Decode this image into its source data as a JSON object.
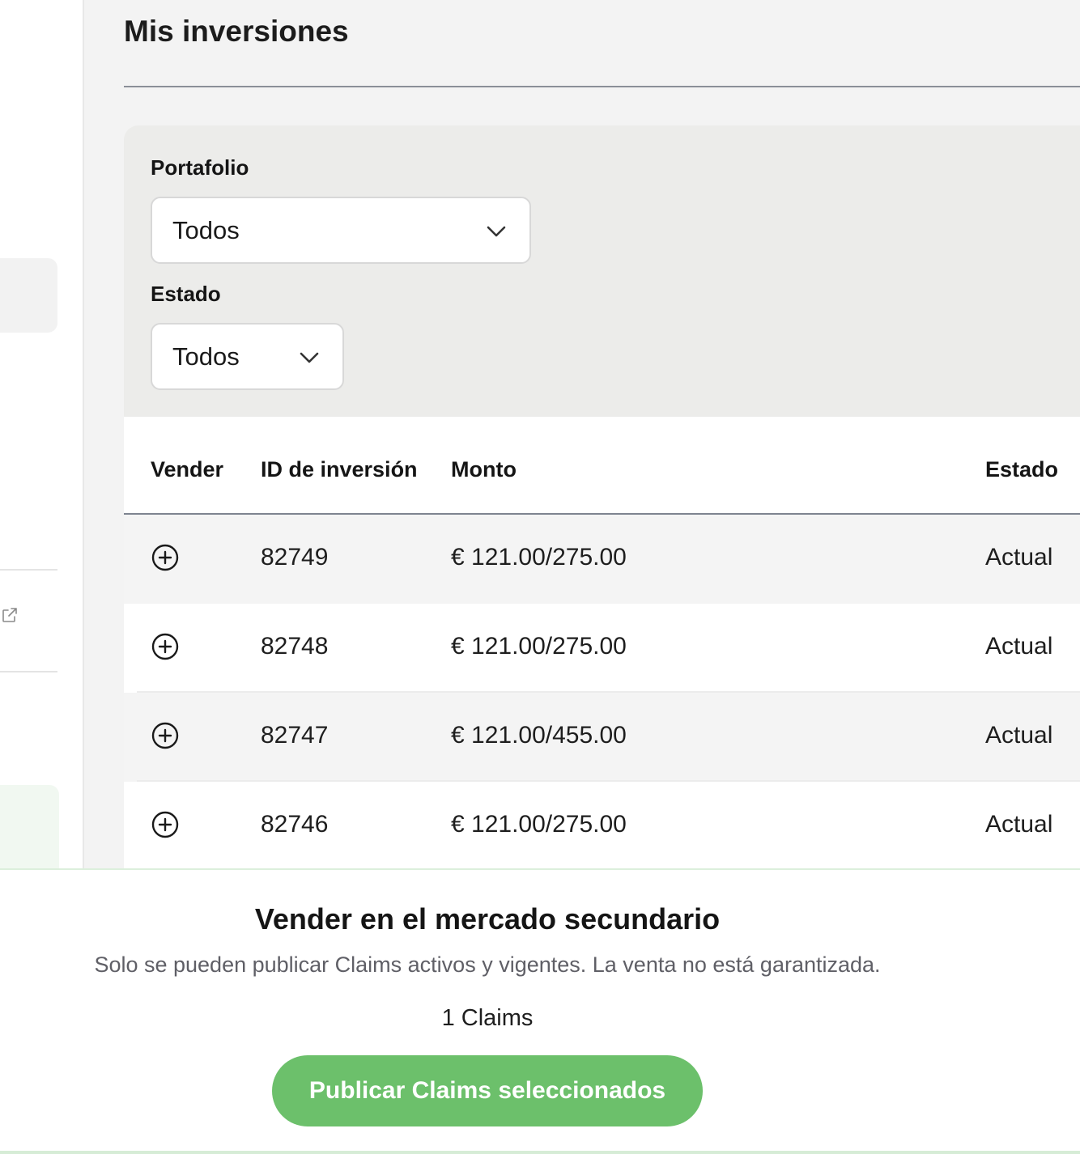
{
  "page": {
    "title": "Mis inversiones"
  },
  "filters": {
    "portfolio": {
      "label": "Portafolio",
      "value": "Todos"
    },
    "status": {
      "label": "Estado",
      "value": "Todos"
    }
  },
  "table": {
    "headers": [
      "Vender",
      "ID de inversión",
      "Monto",
      "Estado"
    ],
    "rows": [
      {
        "id": "82749",
        "amount": "€ 121.00/275.00",
        "status": "Actual"
      },
      {
        "id": "82748",
        "amount": "€ 121.00/275.00",
        "status": "Actual"
      },
      {
        "id": "82747",
        "amount": "€ 121.00/455.00",
        "status": "Actual"
      },
      {
        "id": "82746",
        "amount": "€ 121.00/275.00",
        "status": "Actual"
      }
    ]
  },
  "sell_panel": {
    "title": "Vender en el mercado secundario",
    "subtitle": "Solo se pueden publicar Claims activos y vigentes. La venta no está garantizada.",
    "count": "1 Claims",
    "button": "Publicar Claims seleccionados"
  },
  "icons": {
    "add": "plus-circle-icon",
    "dropdown": "chevron-down-icon",
    "external": "external-link-icon"
  },
  "colors": {
    "accent_green": "#6cc06b",
    "background": "#f3f3f3",
    "filter_panel": "#ececea"
  }
}
